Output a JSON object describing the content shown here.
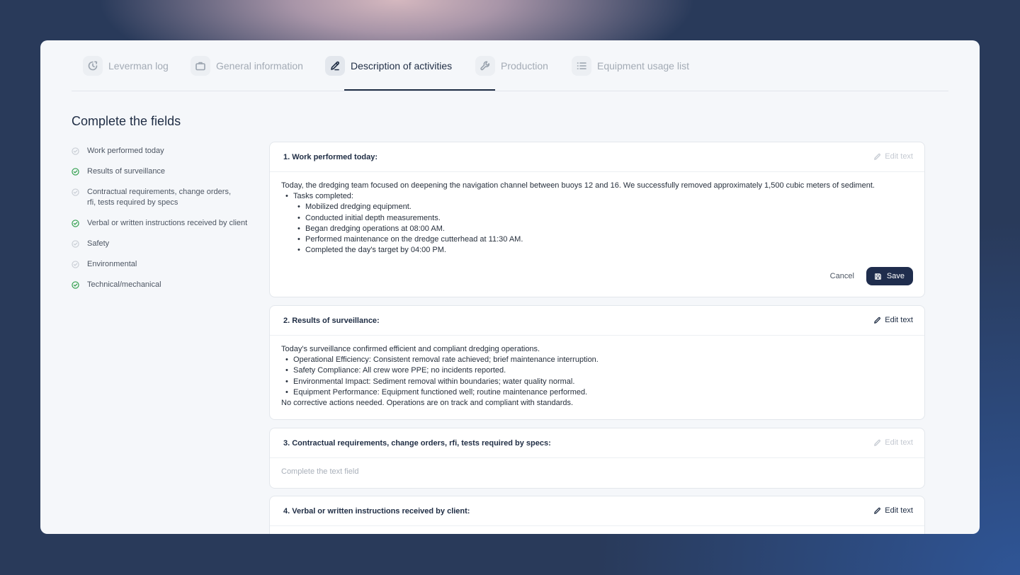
{
  "tabs": [
    {
      "label": "Leverman log",
      "icon": "clock-icon",
      "active": false
    },
    {
      "label": "General information",
      "icon": "briefcase-icon",
      "active": false
    },
    {
      "label": "Description of activities",
      "icon": "pen-icon",
      "active": true
    },
    {
      "label": "Production",
      "icon": "wrench-icon",
      "active": false
    },
    {
      "label": "Equipment usage list",
      "icon": "list-icon",
      "active": false
    }
  ],
  "heading": "Complete the fields",
  "checklist": [
    {
      "label": "Work performed today",
      "done": false
    },
    {
      "label": "Results of surveillance",
      "done": true
    },
    {
      "label": "Contractual requirements, change orders, rfi, tests required by specs",
      "done": false
    },
    {
      "label": "Verbal or written instructions received by client",
      "done": true
    },
    {
      "label": "Safety",
      "done": false
    },
    {
      "label": "Environmental",
      "done": false
    },
    {
      "label": "Technical/mechanical",
      "done": true
    }
  ],
  "colors": {
    "done": "#2f9e4b",
    "pending": "#c9ced5",
    "accent": "#1f2d4d"
  },
  "sections": [
    {
      "title": "1. Work performed today:",
      "edit_label": "Edit text",
      "edit_disabled": true,
      "intro": "Today, the dredging team focused on deepening the navigation channel between buoys 12 and 16. We successfully removed approximately 1,500 cubic meters of sediment.",
      "bullet_heading": "Tasks completed:",
      "tasks": [
        "Mobilized dredging equipment.",
        "Conducted initial depth measurements.",
        "Began dredging operations at 08:00 AM.",
        "Performed maintenance on the dredge cutterhead at 11:30 AM.",
        "Completed the day's target by 04:00 PM."
      ],
      "cancel_label": "Cancel",
      "save_label": "Save"
    },
    {
      "title": "2. Results of surveillance:",
      "edit_label": "Edit text",
      "edit_disabled": false,
      "intro": "Today's surveillance confirmed efficient and compliant dredging operations.",
      "bullets": [
        "Operational Efficiency: Consistent removal rate achieved; brief maintenance interruption.",
        "Safety Compliance: All crew wore PPE; no incidents reported.",
        "Environmental Impact: Sediment removal within boundaries; water quality normal.",
        "Equipment Performance: Equipment functioned well; routine maintenance performed."
      ],
      "outro": "No corrective actions needed. Operations are on track and compliant with standards."
    },
    {
      "title": "3. Contractual requirements, change orders, rfi, tests required by specs:",
      "edit_label": "Edit text",
      "edit_disabled": true,
      "placeholder": "Complete the text field"
    },
    {
      "title": "4. Verbal or written instructions received by client:",
      "edit_label": "Edit text",
      "edit_disabled": false
    }
  ]
}
